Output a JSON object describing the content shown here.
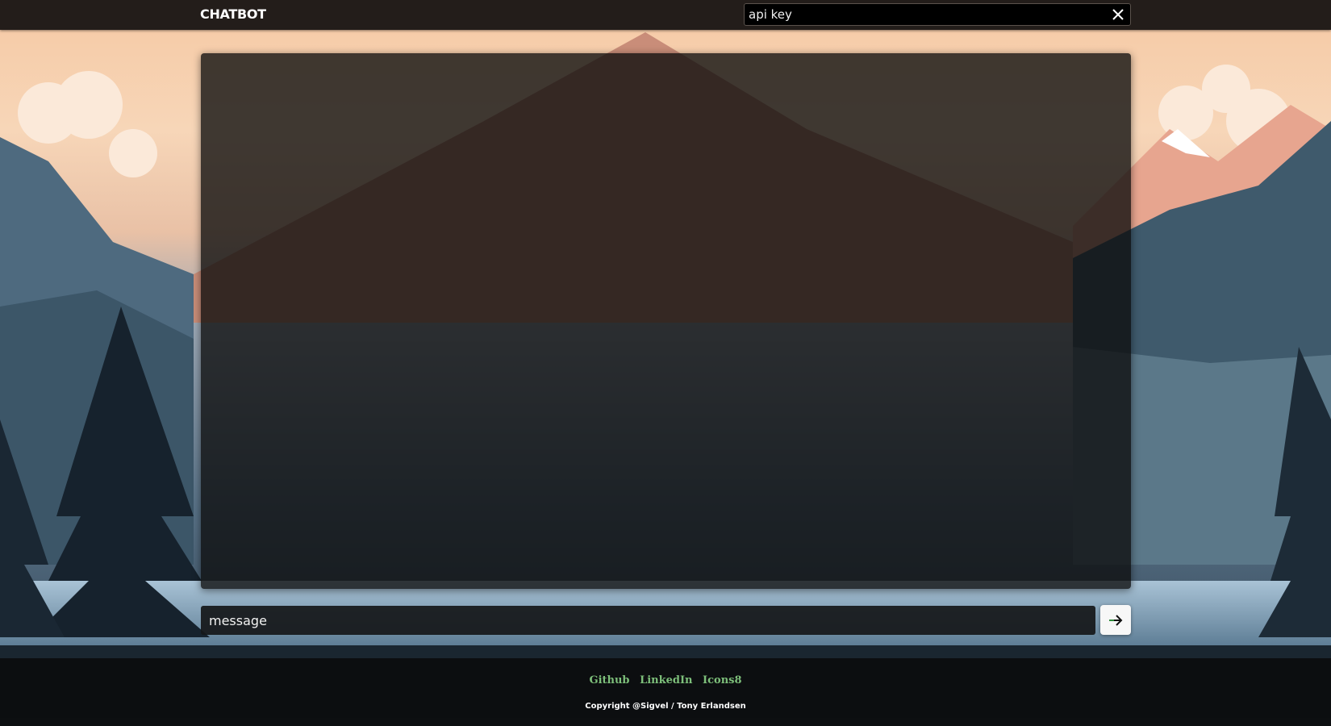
{
  "header": {
    "brand": "CHATBOT",
    "api_key_placeholder": "api key",
    "api_key_value": "api key",
    "clear_icon": "close-icon"
  },
  "chat": {
    "message_placeholder": "message",
    "send_icon": "arrow-right-icon"
  },
  "footer": {
    "links": [
      "Github",
      "LinkedIn",
      "Icons8"
    ],
    "copyright": "Copyright @Sigvel / Tony Erlandsen",
    "link_color": "#7dbf7a"
  },
  "colors": {
    "topbar": "#231d1a",
    "panel": "#0c0c0c",
    "send_button": "#f7f7f7"
  }
}
